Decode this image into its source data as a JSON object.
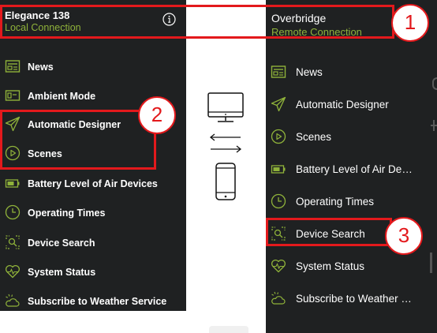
{
  "left_panel": {
    "title": "Elegance 138",
    "subtitle": "Local Connection",
    "items": [
      {
        "label": "News",
        "icon": "news-icon"
      },
      {
        "label": "Ambient Mode",
        "icon": "ambient-mode-icon"
      },
      {
        "label": "Automatic Designer",
        "icon": "paper-plane-icon"
      },
      {
        "label": "Scenes",
        "icon": "play-circle-icon"
      },
      {
        "label": "Battery Level of Air Devices",
        "icon": "battery-icon"
      },
      {
        "label": "Operating Times",
        "icon": "clock-icon"
      },
      {
        "label": "Device Search",
        "icon": "device-search-icon"
      },
      {
        "label": "System Status",
        "icon": "heart-pulse-icon"
      },
      {
        "label": "Subscribe to Weather Service",
        "icon": "weather-icon"
      }
    ]
  },
  "right_panel": {
    "title": "Overbridge",
    "subtitle": "Remote Connection",
    "items": [
      {
        "label": "News",
        "icon": "news-icon"
      },
      {
        "label": "Automatic Designer",
        "icon": "paper-plane-icon"
      },
      {
        "label": "Scenes",
        "icon": "play-circle-icon"
      },
      {
        "label": "Battery Level of Air De…",
        "icon": "battery-icon"
      },
      {
        "label": "Operating Times",
        "icon": "clock-icon"
      },
      {
        "label": "Device Search",
        "icon": "device-search-icon"
      },
      {
        "label": "System Status",
        "icon": "heart-pulse-icon"
      },
      {
        "label": "Subscribe to Weather …",
        "icon": "weather-icon"
      }
    ]
  },
  "callouts": {
    "one": "1",
    "two": "2",
    "three": "3"
  },
  "colors": {
    "panel_bg": "#1f2122",
    "accent_green": "#8fb23a",
    "highlight_red": "#e3191c"
  }
}
